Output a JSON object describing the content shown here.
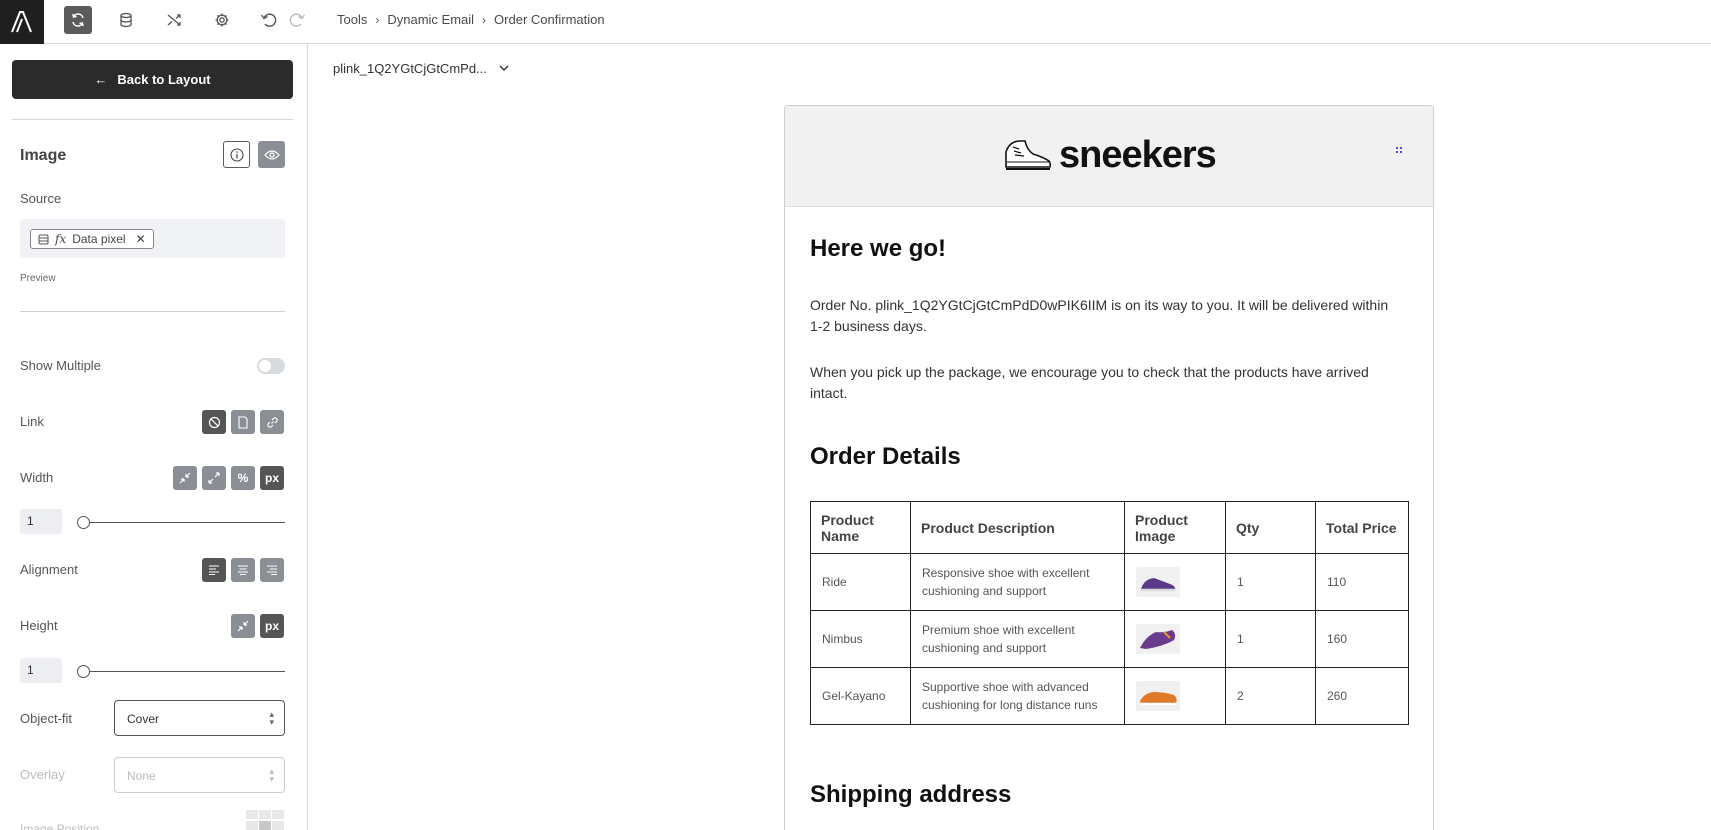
{
  "toolbar": {
    "logo": "A",
    "icons": [
      "sync-icon",
      "database-icon",
      "shuffle-icon",
      "gear-icon",
      "undo-icon",
      "redo-icon"
    ]
  },
  "breadcrumb": {
    "items": [
      "Tools",
      "Dynamic Email",
      "Order Confirmation"
    ]
  },
  "sidebar": {
    "back_label": "Back to Layout",
    "section_title": "Image",
    "source_label": "Source",
    "source_chip": "Data pixel",
    "source_chip_fx": "fx",
    "preview_label": "Preview",
    "show_multiple_label": "Show Multiple",
    "show_multiple_on": false,
    "link_label": "Link",
    "width_label": "Width",
    "width_unit_percent": "%",
    "width_unit_px": "px",
    "width_value": "1",
    "alignment_label": "Alignment",
    "height_label": "Height",
    "height_unit_px": "px",
    "height_value": "1",
    "object_fit_label": "Object-fit",
    "object_fit_value": "Cover",
    "overlay_label": "Overlay",
    "overlay_value": "None",
    "image_position_label": "Image Position"
  },
  "canvas": {
    "record_select": "plink_1Q2YGtCjGtCmPd..."
  },
  "email": {
    "brand": "sneekers",
    "heading": "Here we go!",
    "para1": "Order No. plink_1Q2YGtCjGtCmPdD0wPIK6IIM is on its way to you. It will be delivered within 1-2 business days.",
    "para2": "When you pick up the package, we encourage you to check that the products have arrived intact.",
    "order_details_heading": "Order Details",
    "table_headers": [
      "Product Name",
      "Product Description",
      "Product Image",
      "Qty",
      "Total Price"
    ],
    "rows": [
      {
        "name": "Ride",
        "description": "Responsive shoe with excellent cushioning and support",
        "qty": "1",
        "price": "110",
        "shoe_color": "#5b3a8c"
      },
      {
        "name": "Nimbus",
        "description": "Premium shoe with excellent cushioning and support",
        "qty": "1",
        "price": "160",
        "shoe_color": "#6a3a8c"
      },
      {
        "name": "Gel-Kayano",
        "description": "Supportive shoe with advanced cushioning for long distance runs",
        "qty": "2",
        "price": "260",
        "shoe_color": "#e07a2a"
      }
    ],
    "shipping_heading": "Shipping address"
  }
}
